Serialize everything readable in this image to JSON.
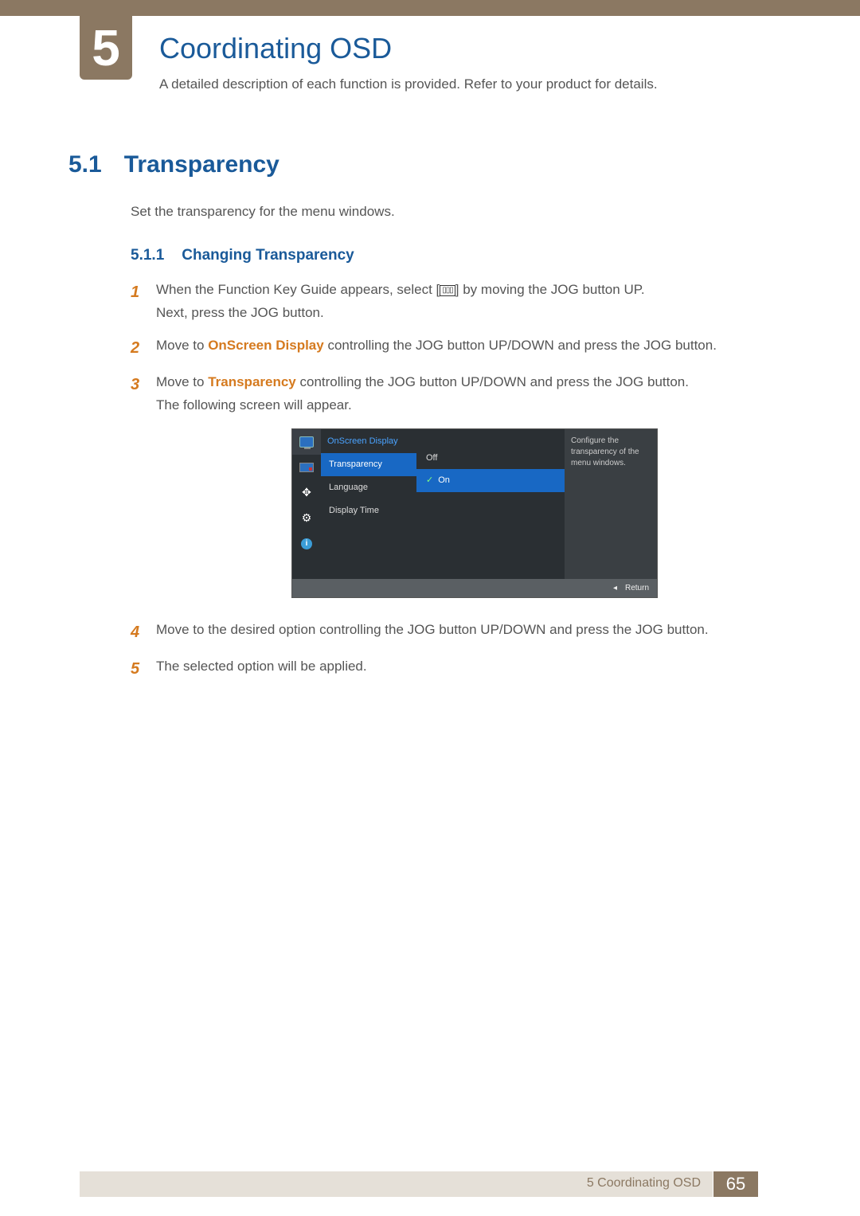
{
  "chapter": {
    "number": "5",
    "title": "Coordinating OSD",
    "subtitle": "A detailed description of each function is provided. Refer to your product for details."
  },
  "section": {
    "number": "5.1",
    "title": "Transparency",
    "body": "Set the transparency for the menu windows."
  },
  "subsection": {
    "number": "5.1.1",
    "title": "Changing Transparency"
  },
  "steps": {
    "s1a": "When the Function Key Guide appears, select [",
    "s1b": "] by moving the JOG button UP.",
    "s1c": "Next, press the JOG button.",
    "s2a": "Move to ",
    "s2hl": "OnScreen Display",
    "s2b": " controlling the JOG button UP/DOWN and press the JOG button.",
    "s3a": "Move to ",
    "s3hl": "Transparency",
    "s3b": " controlling the JOG button UP/DOWN and press the JOG button.",
    "s3c": "The following screen will appear.",
    "s4": "Move to the desired option controlling the JOG button UP/DOWN and press the JOG button.",
    "s5": "The selected option will be applied."
  },
  "step_numbers": {
    "n1": "1",
    "n2": "2",
    "n3": "3",
    "n4": "4",
    "n5": "5"
  },
  "osd": {
    "header": "OnScreen Display",
    "menu": {
      "transparency": "Transparency",
      "language": "Language",
      "display_time": "Display Time"
    },
    "options": {
      "off": "Off",
      "on": "On"
    },
    "info": "Configure the transparency of the menu windows.",
    "return": "Return",
    "arrow": "◂"
  },
  "footer": {
    "chapter_label": "5 Coordinating OSD",
    "page": "65"
  },
  "icons": {
    "menu_glyph": "▯▯▯",
    "info_glyph": "i",
    "gear_glyph": "⚙",
    "arrows_glyph": "✥"
  }
}
